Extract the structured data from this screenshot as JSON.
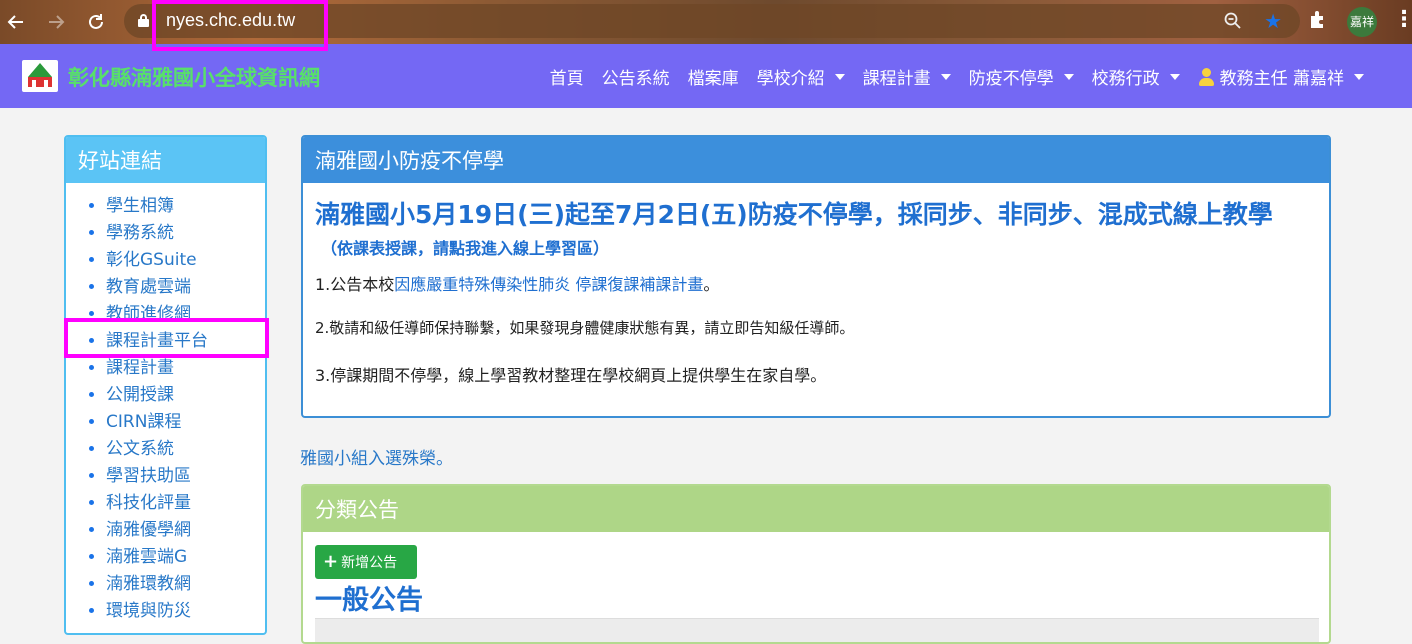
{
  "browser": {
    "url": "nyes.chc.edu.tw",
    "profile_initials": "嘉祥",
    "icons": [
      "back-arrow-icon",
      "forward-arrow-icon",
      "reload-icon",
      "lock-icon",
      "zoom-icon",
      "star-icon",
      "puzzle-icon",
      "kebab-menu-icon"
    ]
  },
  "navbar": {
    "brand": "彰化縣湳雅國小全球資訊網",
    "menu": [
      {
        "label": "首頁"
      },
      {
        "label": "公告系統"
      },
      {
        "label": "檔案庫"
      },
      {
        "label": "學校介紹"
      },
      {
        "label": "課程計畫"
      },
      {
        "label": "防疫不停學"
      },
      {
        "label": "校務行政"
      },
      {
        "label": "教務主任 蕭嘉祥"
      }
    ],
    "colors": {
      "background": "#7468f4",
      "brand": "#58e06a"
    }
  },
  "sidebar": {
    "title": "好站連結",
    "links": [
      "學生相簿",
      "學務系統",
      "彰化GSuite",
      "教育處雲端",
      "教師進修網",
      "課程計畫平台",
      "課程計畫",
      "公開授課",
      "CIRN課程",
      "公文系統",
      "學習扶助區",
      "科技化評量",
      "湳雅優學網",
      "湳雅雲端G",
      "湳雅環教網",
      "環境與防災"
    ]
  },
  "panel1": {
    "title": "湳雅國小防疫不停學",
    "headline_a": "湳雅國小5月19日(三)起",
    "headline_b": "至7月2日(五)防疫不停學，採同步、非同步、混成式線上教學",
    "subhead": "（依課表授課，請點我進入線上學習區）",
    "p1_prefix": "1.公告本校",
    "p1_link": "因應嚴重特殊傳染性肺炎 停課復課補課計畫",
    "p1_suffix": "。",
    "p2": "2.敬請和級任導師保持聯繫，如果發現身體健康狀態有異，請立即告知級任導師。",
    "p3": "3.停課期間不停學，線上學習教材整理在學校網頁上提供學生在家自學。"
  },
  "marquee": "雅國小組入選殊榮。",
  "panel2": {
    "title": "分類公告",
    "add_button": "新增公告",
    "section_title": "一般公告"
  }
}
